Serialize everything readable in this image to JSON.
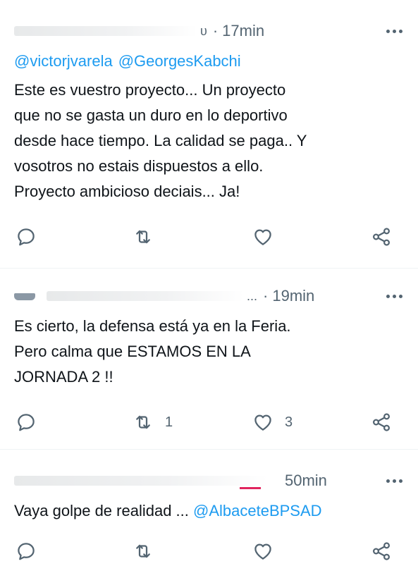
{
  "tweets": [
    {
      "author_trunc": "ᴜ",
      "time": "17min",
      "mentions": [
        "@victorjvarela",
        "@GeorgesKabchi"
      ],
      "text": "Este es vuestro proyecto... Un proyecto\nque no se gasta un duro en lo deportivo\ndesde hace tiempo. La calidad se paga.. Y\nvosotros no estais dispuestos a ello.\nProyecto ambicioso deciais... Ja!",
      "retweets": "",
      "likes": ""
    },
    {
      "author_trunc": "...",
      "time": "19min",
      "text": "Es cierto, la defensa está ya en la Feria.\nPero calma que ESTAMOS EN LA\nJORNADA 2 !!",
      "retweets": "1",
      "likes": "3"
    },
    {
      "author_trunc": "",
      "time": "50min",
      "text_plain": "Vaya golpe de realidad ...",
      "mention": "@AlbaceteBPSAD",
      "retweets": "",
      "likes": ""
    }
  ],
  "icons": {
    "reply": "reply-icon",
    "retweet": "retweet-icon",
    "like": "heart-icon",
    "share": "share-icon",
    "more": "more-icon"
  },
  "colors": {
    "link": "#1d9bf0",
    "muted": "#536471",
    "text": "#0f1419",
    "divider": "#eff3f4"
  }
}
